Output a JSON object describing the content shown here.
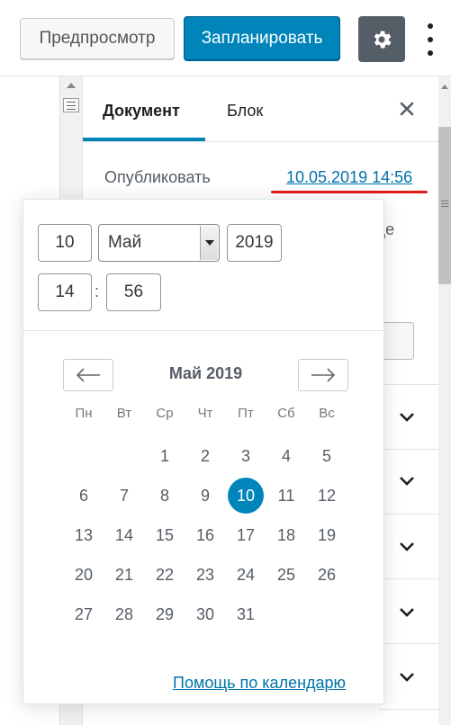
{
  "toolbar": {
    "preview_label": "Предпросмотр",
    "schedule_label": "Запланировать",
    "settings_icon": "gear-icon",
    "more_icon": "vertical-ellipsis-icon"
  },
  "sidebar": {
    "tabs": [
      {
        "label": "Документ",
        "active": true
      },
      {
        "label": "Блок",
        "active": false
      }
    ],
    "close_icon": "close-icon",
    "publish_label": "Опубликовать",
    "publish_value": "10.05.2019 14:56",
    "partial_text": "це"
  },
  "datepicker": {
    "day": "10",
    "month": "Май",
    "year": "2019",
    "hour": "14",
    "minute": "56",
    "time_separator": ":",
    "month_title": "Май 2019",
    "prev_icon": "arrow-left-icon",
    "next_icon": "arrow-right-icon",
    "weekdays": [
      "Пн",
      "Вт",
      "Ср",
      "Чт",
      "Пт",
      "Сб",
      "Вс"
    ],
    "weeks": [
      [
        "",
        "",
        "1",
        "2",
        "3",
        "4",
        "5"
      ],
      [
        "6",
        "7",
        "8",
        "9",
        "10",
        "11",
        "12"
      ],
      [
        "13",
        "14",
        "15",
        "16",
        "17",
        "18",
        "19"
      ],
      [
        "20",
        "21",
        "22",
        "23",
        "24",
        "25",
        "26"
      ],
      [
        "27",
        "28",
        "29",
        "30",
        "31",
        "",
        ""
      ]
    ],
    "selected_day": "10",
    "help_link": "Помощь по календарю"
  },
  "colors": {
    "accent": "#0085ba",
    "link": "#0073aa",
    "highlight_underline": "#e31b1b",
    "gear_button_bg": "#555d66"
  }
}
